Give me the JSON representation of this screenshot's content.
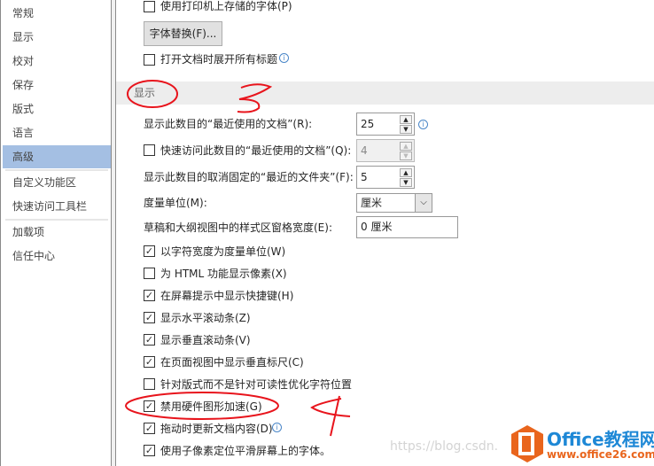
{
  "sidebar": {
    "items": [
      {
        "label": "常规"
      },
      {
        "label": "显示"
      },
      {
        "label": "校对"
      },
      {
        "label": "保存"
      },
      {
        "label": "版式"
      },
      {
        "label": "语言"
      },
      {
        "label": "高级",
        "selected": true
      },
      {
        "label": "自定义功能区"
      },
      {
        "label": "快速访问工具栏"
      },
      {
        "label": "加载项"
      },
      {
        "label": "信任中心"
      }
    ]
  },
  "top": {
    "print_fonts": {
      "label": "使用打印机上存储的字体(P)",
      "checked": false
    },
    "font_sub_button": "字体替换(F)...",
    "expand_headings": {
      "label": "打开文档时展开所有标题",
      "checked": false
    }
  },
  "display": {
    "section_title": "显示",
    "recent_docs": {
      "label": "显示此数目的“最近使用的文档”(R):",
      "value": "25"
    },
    "quick_recent": {
      "label": "快速访问此数目的“最近使用的文档”(Q):",
      "value": "4",
      "checked": false
    },
    "recent_folders": {
      "label": "显示此数目的取消固定的“最近的文件夹”(F):",
      "value": "5"
    },
    "units": {
      "label": "度量单位(M):",
      "value": "厘米"
    },
    "style_width": {
      "label": "草稿和大纲视图中的样式区窗格宽度(E):",
      "value": "0 厘米"
    },
    "options": [
      {
        "label": "以字符宽度为度量单位(W)",
        "checked": true
      },
      {
        "label": "为 HTML 功能显示像素(X)",
        "checked": false
      },
      {
        "label": "在屏幕提示中显示快捷键(H)",
        "checked": true
      },
      {
        "label": "显示水平滚动条(Z)",
        "checked": true
      },
      {
        "label": "显示垂直滚动条(V)",
        "checked": true
      },
      {
        "label": "在页面视图中显示垂直标尺(C)",
        "checked": true
      },
      {
        "label": "针对版式而不是针对可读性优化字符位置",
        "checked": false
      },
      {
        "label": "禁用硬件图形加速(G)",
        "checked": true
      },
      {
        "label": "拖动时更新文档内容(D)",
        "checked": true
      },
      {
        "label": "使用子像素定位平滑屏幕上的字体。",
        "checked": true
      }
    ]
  },
  "annotations": {
    "step3": "3",
    "step4": "4",
    "color": "#e8141c"
  },
  "watermark": {
    "text": "https://blog.csdn.",
    "logo_text": "Office教程网",
    "logo_url": "www.office26.com",
    "logo_color": "#e9651d",
    "blue": "#1e88d6"
  }
}
